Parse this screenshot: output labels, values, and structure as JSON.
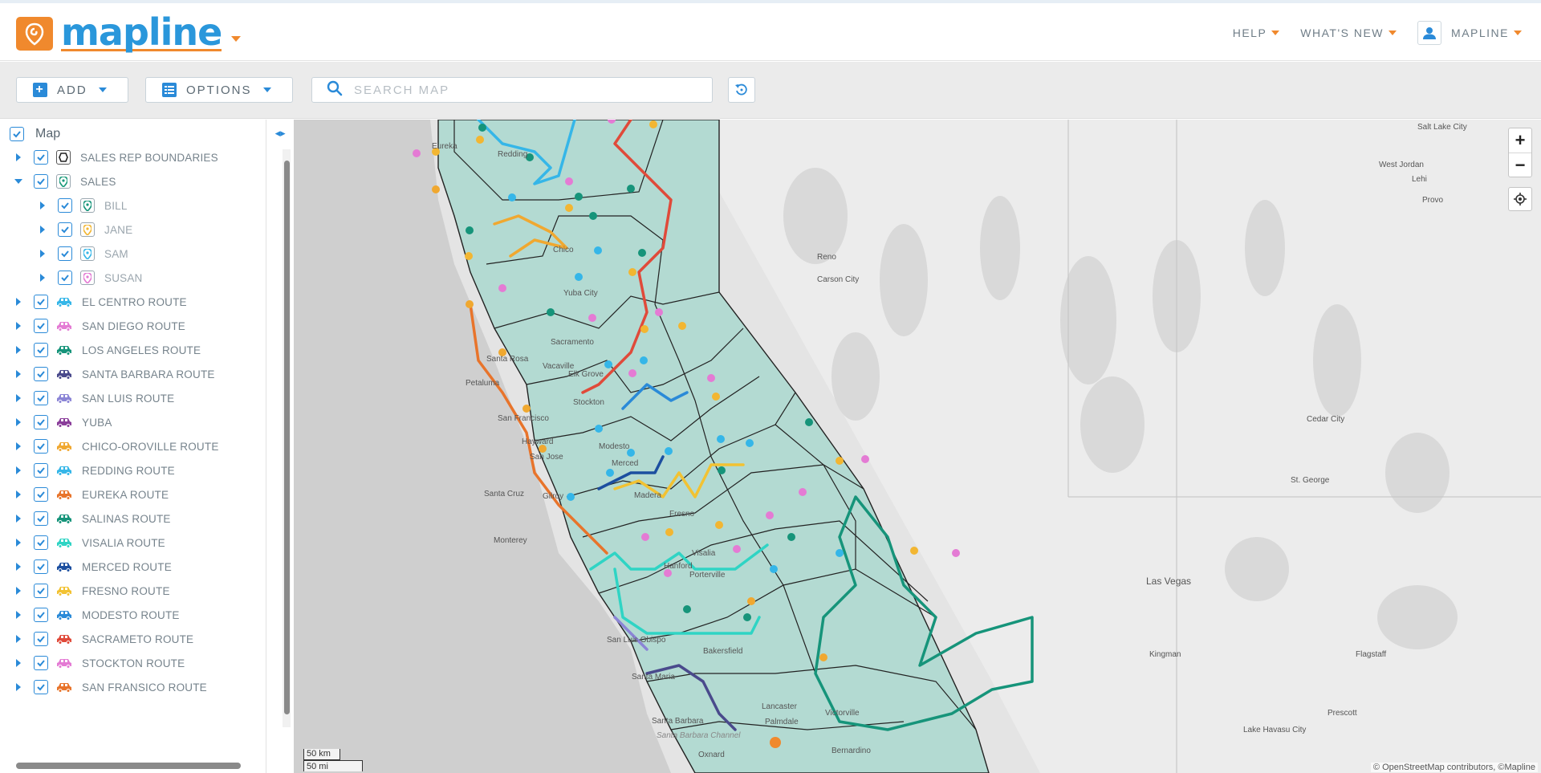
{
  "header": {
    "logo_text": "mapline",
    "nav": [
      {
        "label": "HELP"
      },
      {
        "label": "WHAT'S NEW"
      },
      {
        "label": "MAPLINE"
      }
    ]
  },
  "toolbar": {
    "add_label": "ADD",
    "options_label": "OPTIONS",
    "search_placeholder": "SEARCH MAP"
  },
  "sidebar": {
    "root_label": "Map",
    "items": [
      {
        "label": "SALES REP BOUNDARIES",
        "icon": "boundary-icon",
        "color": "#333333"
      },
      {
        "label": "SALES",
        "icon": "pin-icon",
        "color": "#1a9a7a"
      },
      {
        "label": "BILL",
        "icon": "pin-icon",
        "color": "#16947a"
      },
      {
        "label": "JANE",
        "icon": "pin-icon",
        "color": "#f2b632"
      },
      {
        "label": "SAM",
        "icon": "pin-icon",
        "color": "#35b6e8"
      },
      {
        "label": "SUSAN",
        "icon": "pin-icon",
        "color": "#e47bd4"
      },
      {
        "label": "EL CENTRO ROUTE",
        "icon": "car-icon",
        "color": "#35b6e8"
      },
      {
        "label": "SAN DIEGO ROUTE",
        "icon": "car-icon",
        "color": "#e47bd4"
      },
      {
        "label": "LOS ANGELES ROUTE",
        "icon": "car-icon",
        "color": "#16947a"
      },
      {
        "label": "SANTA BARBARA ROUTE",
        "icon": "car-icon",
        "color": "#4a4a8c"
      },
      {
        "label": "SAN LUIS ROUTE",
        "icon": "car-icon",
        "color": "#8b85d6"
      },
      {
        "label": "YUBA",
        "icon": "car-icon",
        "color": "#8a3d9a"
      },
      {
        "label": "CHICO-OROVILLE ROUTE",
        "icon": "car-icon",
        "color": "#f0a830"
      },
      {
        "label": "REDDING ROUTE",
        "icon": "car-icon",
        "color": "#35b6e8"
      },
      {
        "label": "EUREKA ROUTE",
        "icon": "car-icon",
        "color": "#e8742b"
      },
      {
        "label": "SALINAS ROUTE",
        "icon": "car-icon",
        "color": "#16947a"
      },
      {
        "label": "VISALIA ROUTE",
        "icon": "car-icon",
        "color": "#2fd4c4"
      },
      {
        "label": "MERCED ROUTE",
        "icon": "car-icon",
        "color": "#1c4fa0"
      },
      {
        "label": "FRESNO ROUTE",
        "icon": "car-icon",
        "color": "#f2c232"
      },
      {
        "label": "MODESTO ROUTE",
        "icon": "car-icon",
        "color": "#2a8ad8"
      },
      {
        "label": "SACRAMETO ROUTE",
        "icon": "car-icon",
        "color": "#e04a3a"
      },
      {
        "label": "STOCKTON ROUTE",
        "icon": "car-icon",
        "color": "#e47bd4"
      },
      {
        "label": "SAN FRANSICO ROUTE",
        "icon": "car-icon",
        "color": "#e8742b"
      }
    ]
  },
  "map": {
    "places": [
      "Eureka",
      "Redding",
      "Chico",
      "Yuba City",
      "Sacramento",
      "Santa Rosa",
      "Vacaville",
      "Petaluma",
      "Elk Grove",
      "Stockton",
      "San Francisco",
      "Hayward",
      "San Jose",
      "Modesto",
      "Merced",
      "Madera",
      "Fresno",
      "Santa Cruz",
      "Gilroy",
      "Monterey",
      "Visalia",
      "Hanford",
      "Porterville",
      "Bakersfield",
      "San Luis Obispo",
      "Santa Maria",
      "Santa Barbara",
      "Oxnard",
      "Palmdale",
      "Lancaster",
      "Victorville",
      "Bernardino",
      "Reno",
      "Carson City",
      "Salt Lake City",
      "West Jordan",
      "Lehi",
      "Provo",
      "Cedar City",
      "St. George",
      "Las Vegas",
      "Kingman",
      "Flagstaff",
      "Prescott",
      "Lake Havasu City",
      "Santa Barbara Channel"
    ],
    "scale_km": "50 km",
    "scale_mi": "50 mi",
    "attribution": "© OpenStreetMap contributors, ©Mapline",
    "zoom_in": "+",
    "zoom_out": "−"
  }
}
